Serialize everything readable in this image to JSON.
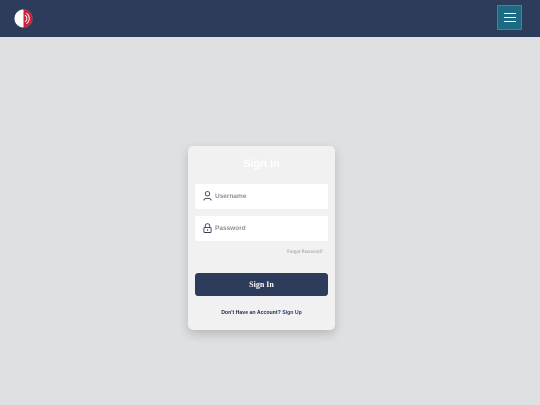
{
  "header": {
    "logo_icon": "app-logo-icon",
    "menu_icon": "hamburger-menu-icon",
    "bar_color": "#2e3c5c",
    "menu_button_color": "#1d6b82"
  },
  "login": {
    "title": "Sign In",
    "username": {
      "placeholder": "Username",
      "value": "",
      "icon": "user-icon"
    },
    "password": {
      "placeholder": "Password",
      "value": "",
      "icon": "lock-icon"
    },
    "forgot_password": "Forgot Password?",
    "submit_label": "Sign In",
    "no_account_text": "Don't Have an Account?",
    "signup_link": "Sign Up"
  }
}
